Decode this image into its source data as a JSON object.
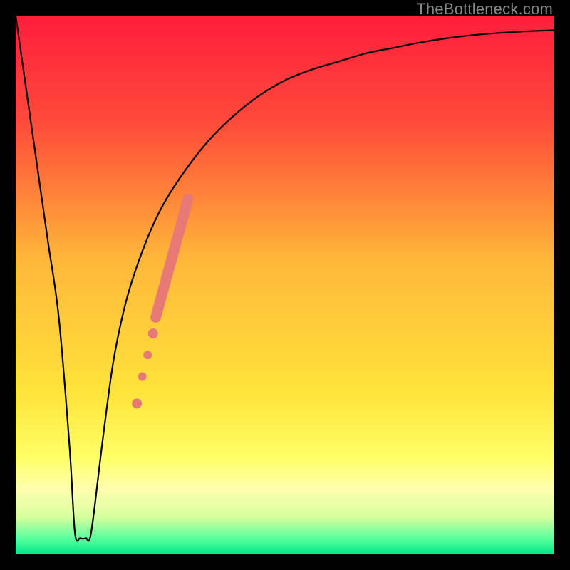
{
  "watermark": "TheBottleneck.com",
  "chart_data": {
    "type": "line",
    "title": "",
    "xlabel": "",
    "ylabel": "",
    "xlim": [
      0,
      100
    ],
    "ylim": [
      0,
      100
    ],
    "grid": false,
    "background": {
      "type": "vertical-gradient",
      "stops": [
        {
          "pos": 0.0,
          "color": "#ff1e3c"
        },
        {
          "pos": 0.2,
          "color": "#ff4b3a"
        },
        {
          "pos": 0.45,
          "color": "#ffb63a"
        },
        {
          "pos": 0.7,
          "color": "#ffe43a"
        },
        {
          "pos": 0.82,
          "color": "#ffff66"
        },
        {
          "pos": 0.88,
          "color": "#ffffb0"
        },
        {
          "pos": 0.93,
          "color": "#d8ff9e"
        },
        {
          "pos": 0.97,
          "color": "#5cff9e"
        },
        {
          "pos": 1.0,
          "color": "#00e88a"
        }
      ]
    },
    "series": [
      {
        "name": "bottleneck-curve",
        "color": "#000000",
        "x": [
          0,
          2,
          4,
          6,
          8,
          10,
          11,
          12,
          13,
          14,
          16,
          18,
          20,
          22,
          25,
          28,
          32,
          36,
          40,
          45,
          50,
          55,
          60,
          65,
          70,
          75,
          80,
          85,
          90,
          95,
          100
        ],
        "y": [
          100,
          86,
          72,
          58,
          44,
          20,
          4,
          3,
          3,
          4,
          20,
          35,
          45,
          52,
          60,
          66,
          72,
          77,
          81,
          85,
          88,
          90,
          91.5,
          93,
          94,
          95,
          95.8,
          96.4,
          96.8,
          97.1,
          97.3
        ]
      }
    ],
    "markers": {
      "name": "highlight-segment",
      "color": "#e77a74",
      "points": [
        {
          "x": 22.5,
          "y": 28,
          "r": 7
        },
        {
          "x": 23.5,
          "y": 33,
          "r": 6
        },
        {
          "x": 24.5,
          "y": 37,
          "r": 6
        },
        {
          "x": 25.5,
          "y": 41,
          "r": 7
        }
      ],
      "thick_segment": {
        "x1": 26,
        "y1": 44,
        "x2": 32,
        "y2": 66,
        "width": 15
      }
    }
  }
}
